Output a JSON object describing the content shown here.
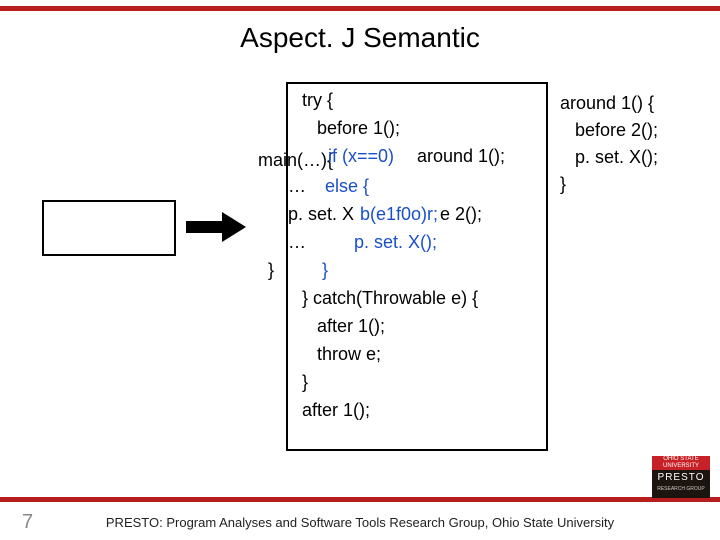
{
  "title": "Aspect. J Semantic",
  "page_number": "7",
  "footer": "PRESTO: Program Analyses and Software Tools Research Group, Ohio State University",
  "logo": {
    "top": "OHIO STATE UNIVERSITY",
    "mid": "PRESTO",
    "bot": "RESEARCH GROUP"
  },
  "around_block": "around 1() {\n   before 2();\n   p. set. X();\n}",
  "code": {
    "l1": "try {",
    "l2": "   before 1();",
    "l3_left": "main(…){",
    "l3_if": "if (x==0)",
    "l3_call": " around 1();",
    "l4a": "…",
    "l4b": " else {",
    "l5_left": "p. set. X",
    "l5_mid_blue": "b(e1f0o)r;",
    "l5_right": "e 2();",
    "l6a": "…",
    "l6b": "p. set. X();",
    "l7a": "}",
    "l7b": "}",
    "l8": "} catch(Throwable e) {",
    "l9": "   after 1();",
    "l10": "   throw e;",
    "l11": "}",
    "l12": "after 1();"
  }
}
